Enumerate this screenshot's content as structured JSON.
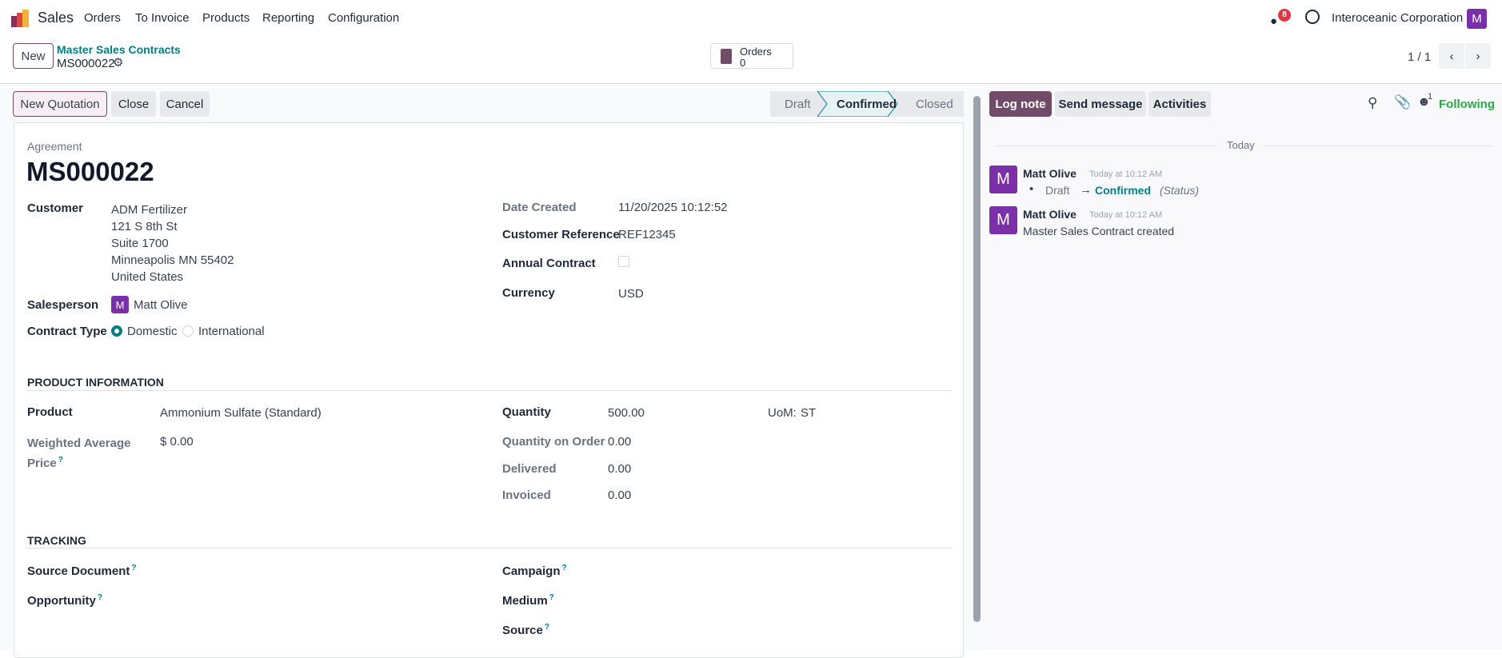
{
  "nav": {
    "app": "Sales",
    "menu": [
      "Orders",
      "To Invoice",
      "Products",
      "Reporting",
      "Configuration"
    ],
    "messages_count": "8",
    "company": "Interoceanic Corporation",
    "user_initial": "M"
  },
  "control": {
    "new_label": "New",
    "breadcrumb_parent": "Master Sales Contracts",
    "record": "MS000022",
    "stat_label": "Orders",
    "stat_value": "0",
    "pager": "1 / 1"
  },
  "actions": {
    "new_quotation": "New Quotation",
    "close": "Close",
    "cancel": "Cancel"
  },
  "statusbar": {
    "stages": [
      "Draft",
      "Confirmed",
      "Closed"
    ],
    "active": "Confirmed"
  },
  "form": {
    "type_label": "Agreement",
    "name": "MS000022",
    "customer_label": "Customer",
    "customer_lines": [
      "ADM Fertilizer",
      "121 S 8th St",
      "Suite 1700",
      "Minneapolis MN 55402",
      "United States"
    ],
    "salesperson_label": "Salesperson",
    "salesperson": "Matt Olive",
    "salesperson_initial": "M",
    "contract_type_label": "Contract Type",
    "contract_types": [
      "Domestic",
      "International"
    ],
    "contract_type_selected": "Domestic",
    "date_created_label": "Date Created",
    "date_created": "11/20/2025 10:12:52",
    "customer_ref_label": "Customer Reference",
    "customer_ref": "REF12345",
    "annual_label": "Annual Contract",
    "annual": false,
    "currency_label": "Currency",
    "currency": "USD",
    "product_section": "PRODUCT INFORMATION",
    "product_label": "Product",
    "product": "Ammonium Sulfate (Standard)",
    "wap_label_1": "Weighted Average",
    "wap_label_2": "Price",
    "wap": "$ 0.00",
    "quantity_label": "Quantity",
    "quantity": "500.00",
    "uom_label": "UoM:",
    "uom": "ST",
    "qty_order_label": "Quantity on Order",
    "qty_order": "0.00",
    "delivered_label": "Delivered",
    "delivered": "0.00",
    "invoiced_label": "Invoiced",
    "invoiced": "0.00",
    "tracking_section": "TRACKING",
    "source_doc_label": "Source Document",
    "opportunity_label": "Opportunity",
    "campaign_label": "Campaign",
    "medium_label": "Medium",
    "source_label": "Source",
    "help": "?"
  },
  "chatter": {
    "log_note": "Log note",
    "send_message": "Send message",
    "activities": "Activities",
    "followers_count": "1",
    "following": "Following",
    "date_sep": "Today",
    "messages": [
      {
        "author": "Matt Olive",
        "initial": "M",
        "time": "Today at 10:12 AM",
        "old": "Draft",
        "arrow": "→",
        "new": "Confirmed",
        "field": "(Status)"
      },
      {
        "author": "Matt Olive",
        "initial": "M",
        "time": "Today at 10:12 AM",
        "body": "Master Sales Contract created"
      }
    ]
  },
  "colors": {
    "primary": "#714b67",
    "teal": "#017e84",
    "avatar": "#7b2fa8",
    "following": "#28a745",
    "badge": "#dc3545"
  }
}
